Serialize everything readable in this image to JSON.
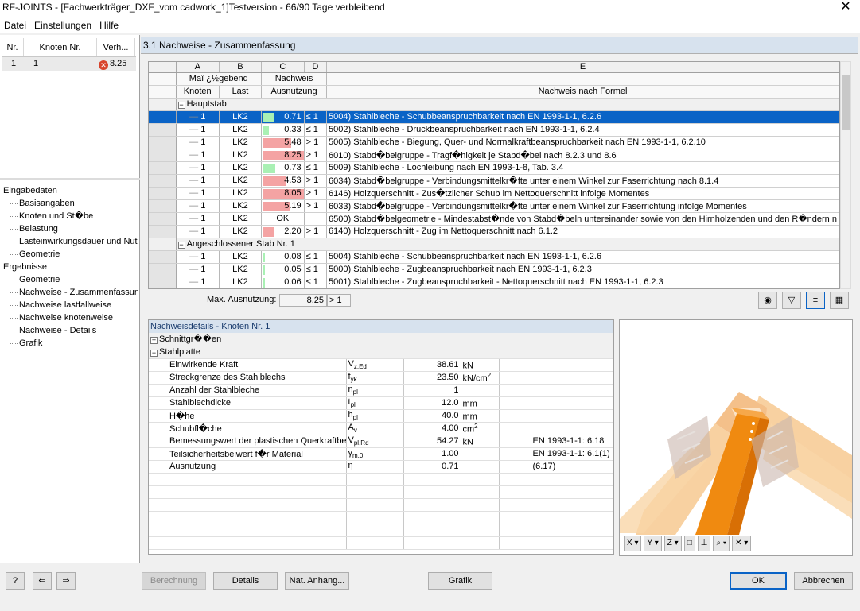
{
  "window": {
    "title": "RF-JOINTS - [Fachwerkträger_DXF_vom cadwork_1]Testversion - 66/90 Tage verbleibend",
    "close": "✕"
  },
  "menu": [
    "Datei",
    "Einstellungen",
    "Hilfe"
  ],
  "left_table": {
    "headers": [
      "Nr.",
      "Knoten Nr.",
      "Verh..."
    ],
    "rows": [
      {
        "nr": "1",
        "knoten": "1",
        "verh": "8.25",
        "status": "error"
      }
    ]
  },
  "tree": [
    {
      "label": "Eingabedaten",
      "level": 0
    },
    {
      "label": "Basisangaben",
      "level": 1
    },
    {
      "label": "Knoten und St�be",
      "level": 1
    },
    {
      "label": "Belastung",
      "level": 1
    },
    {
      "label": "Lasteinwirkungsdauer und Nutz",
      "level": 1
    },
    {
      "label": "Geometrie",
      "level": 1
    },
    {
      "label": "Ergebnisse",
      "level": 0
    },
    {
      "label": "Geometrie",
      "level": 1
    },
    {
      "label": "Nachweise - Zusammenfassung",
      "level": 1
    },
    {
      "label": "Nachweise lastfallweise",
      "level": 1
    },
    {
      "label": "Nachweise knotenweise",
      "level": 1
    },
    {
      "label": "Nachweise - Details",
      "level": 1
    },
    {
      "label": "Grafik",
      "level": 1
    }
  ],
  "main_header": "3.1 Nachweise - Zusammenfassung",
  "grid": {
    "col_letters": [
      "A",
      "B",
      "C",
      "D",
      "E"
    ],
    "head1": {
      "a": "Maï ¿½gebend",
      "c": "Nachweis"
    },
    "head2": {
      "a": "Knoten",
      "b": "Last",
      "c": "Ausnutzung",
      "e": "Nachweis nach Formel"
    },
    "groups": [
      {
        "label": "Hauptstab",
        "rows": [
          {
            "knoten": "1",
            "last": "LK2",
            "ausn": "0.71",
            "util": 0.71,
            "cmp": "≤ 1",
            "formel": "5004) Stahlbleche - Schubbeanspruchbarkeit nach EN 1993-1-1, 6.2.6",
            "selected": true
          },
          {
            "knoten": "1",
            "last": "LK2",
            "ausn": "0.33",
            "util": 0.33,
            "cmp": "≤ 1",
            "formel": "5002) Stahlbleche - Druckbeanspruchbarkeit nach EN 1993-1-1, 6.2.4"
          },
          {
            "knoten": "1",
            "last": "LK2",
            "ausn": "5.48",
            "util": 5.48,
            "cmp": "> 1",
            "formel": "5005) Stahlbleche - Biegung, Quer- und Normalkraftbeanspruchbarkeit nach EN 1993-1-1, 6.2.10"
          },
          {
            "knoten": "1",
            "last": "LK2",
            "ausn": "8.25",
            "util": 8.25,
            "cmp": "> 1",
            "formel": "6010) Stabd�belgruppe - Tragf�higkeit je Stabd�bel nach 8.2.3 und 8.6"
          },
          {
            "knoten": "1",
            "last": "LK2",
            "ausn": "0.73",
            "util": 0.73,
            "cmp": "≤ 1",
            "formel": "5009) Stahlbleche - Lochleibung nach EN 1993-1-8, Tab. 3.4"
          },
          {
            "knoten": "1",
            "last": "LK2",
            "ausn": "4.53",
            "util": 4.53,
            "cmp": "> 1",
            "formel": "6034) Stabd�belgruppe - Verbindungsmittelkr�fte unter einem Winkel zur Faserrichtung nach 8.1.4"
          },
          {
            "knoten": "1",
            "last": "LK2",
            "ausn": "8.05",
            "util": 8.05,
            "cmp": "> 1",
            "formel": "6146) Holzquerschnitt - Zus�tzlicher Schub im Nettoquerschnitt infolge Momentes"
          },
          {
            "knoten": "1",
            "last": "LK2",
            "ausn": "5.19",
            "util": 5.19,
            "cmp": "> 1",
            "formel": "6033) Stabd�belgruppe - Verbindungsmittelkr�fte unter einem Winkel zur Faserrichtung infolge Momentes"
          },
          {
            "knoten": "1",
            "last": "LK2",
            "ausn": "OK",
            "util": 0,
            "cmp": "",
            "formel": "6500) Stabd�belgeometrie - Mindestabst�nde von Stabd�beln untereinander sowie von den Hirnholzenden und den R�ndern n"
          },
          {
            "knoten": "1",
            "last": "LK2",
            "ausn": "2.20",
            "util": 2.2,
            "cmp": "> 1",
            "formel": "6140) Holzquerschnitt - Zug im Nettoquerschnitt nach 6.1.2"
          }
        ]
      },
      {
        "label": "Angeschlossener Stab Nr. 1",
        "rows": [
          {
            "knoten": "1",
            "last": "LK2",
            "ausn": "0.08",
            "util": 0.08,
            "cmp": "≤ 1",
            "formel": "5004) Stahlbleche - Schubbeanspruchbarkeit nach EN 1993-1-1, 6.2.6"
          },
          {
            "knoten": "1",
            "last": "LK2",
            "ausn": "0.05",
            "util": 0.05,
            "cmp": "≤ 1",
            "formel": "5000) Stahlbleche - Zugbeanspruchbarkeit nach EN 1993-1-1, 6.2.3"
          },
          {
            "knoten": "1",
            "last": "LK2",
            "ausn": "0.06",
            "util": 0.06,
            "cmp": "≤ 1",
            "formel": "5001) Stahlbleche - Zugbeanspruchbarkeit - Nettoquerschnitt nach EN 1993-1-1, 6.2.3"
          }
        ]
      }
    ]
  },
  "max": {
    "label": "Max. Ausnutzung:",
    "value": "8.25",
    "cmp": "> 1"
  },
  "details": {
    "title": "Nachweisdetails - Knoten Nr. 1",
    "sections": [
      {
        "label": "Schnittgr��en",
        "expanded": false
      },
      {
        "label": "Stahlplatte",
        "expanded": true
      }
    ],
    "rows": [
      {
        "name": "Einwirkende Kraft",
        "sym": "V",
        "sub": "z,Ed",
        "val": "38.61",
        "unit": "kN",
        "ref": ""
      },
      {
        "name": "Streckgrenze des Stahlblechs",
        "sym": "f",
        "sub": "yk",
        "val": "23.50",
        "unit": "kN/cm",
        "sup": "2",
        "ref": ""
      },
      {
        "name": "Anzahl der Stahlbleche",
        "sym": "n",
        "sub": "pl",
        "val": "1",
        "unit": "",
        "ref": ""
      },
      {
        "name": "Stahlblechdicke",
        "sym": "t",
        "sub": "pl",
        "val": "12.0",
        "unit": "mm",
        "ref": ""
      },
      {
        "name": "H�he",
        "sym": "h",
        "sub": "pl",
        "val": "40.0",
        "unit": "mm",
        "ref": ""
      },
      {
        "name": "Schubfl�che",
        "sym": "A",
        "sub": "v",
        "val": "4.00",
        "unit": "cm",
        "sup": "2",
        "ref": ""
      },
      {
        "name": "Bemessungswert der plastischen Querkraftbea",
        "sym": "V",
        "sub": "pl,Rd",
        "val": "54.27",
        "unit": "kN",
        "ref": "EN 1993-1-1: 6.18"
      },
      {
        "name": "Teilsicherheitsbeiwert f�r Material",
        "sym": "γ",
        "sub": "m,0",
        "val": "1.00",
        "unit": "",
        "ref": "EN 1993-1-1: 6.1(1)"
      },
      {
        "name": "Ausnutzung",
        "sym": "η",
        "sub": "",
        "val": "0.71",
        "unit": "",
        "ref": "(6.17)"
      }
    ]
  },
  "view_toolbar": [
    "X",
    "Y",
    "Z",
    "□",
    "⊥",
    "⌕",
    "✕"
  ],
  "buttons": {
    "berechnung": "Berechnung",
    "details": "Details",
    "nat": "Nat. Anhang...",
    "grafik": "Grafik",
    "ok": "OK",
    "abbrechen": "Abbrechen"
  },
  "colors": {
    "selected": "#0a63c6",
    "ok_fill": "#a9f0b4",
    "fail_fill": "#f4a3a3",
    "header": "#d7e2ee",
    "orange": "#f5a030"
  }
}
